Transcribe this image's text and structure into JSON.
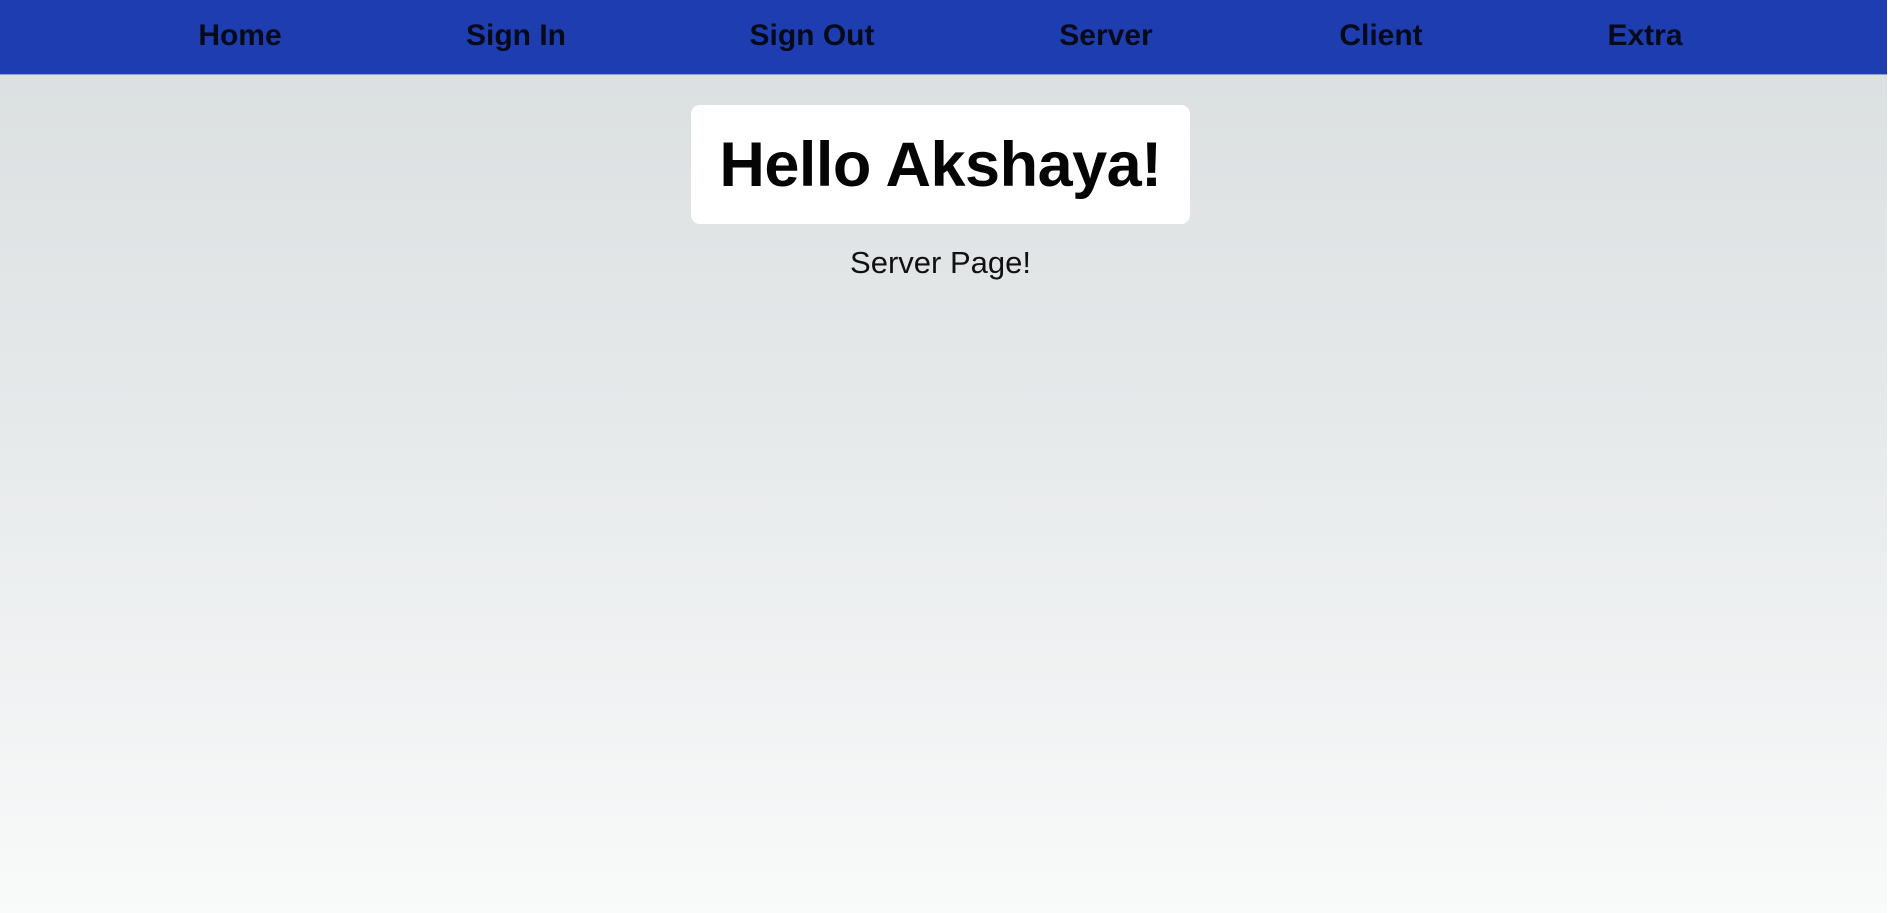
{
  "nav": {
    "items": [
      {
        "label": "Home"
      },
      {
        "label": "Sign In"
      },
      {
        "label": "Sign Out"
      },
      {
        "label": "Server"
      },
      {
        "label": "Client"
      },
      {
        "label": "Extra"
      }
    ]
  },
  "main": {
    "greeting": "Hello Akshaya!",
    "subtitle": "Server Page!"
  },
  "colors": {
    "nav_background": "#1d3db0",
    "nav_text": "#060b1a",
    "card_background": "#ffffff",
    "page_gradient_top": "#d9dedf",
    "page_gradient_bottom": "#f9fafa"
  }
}
